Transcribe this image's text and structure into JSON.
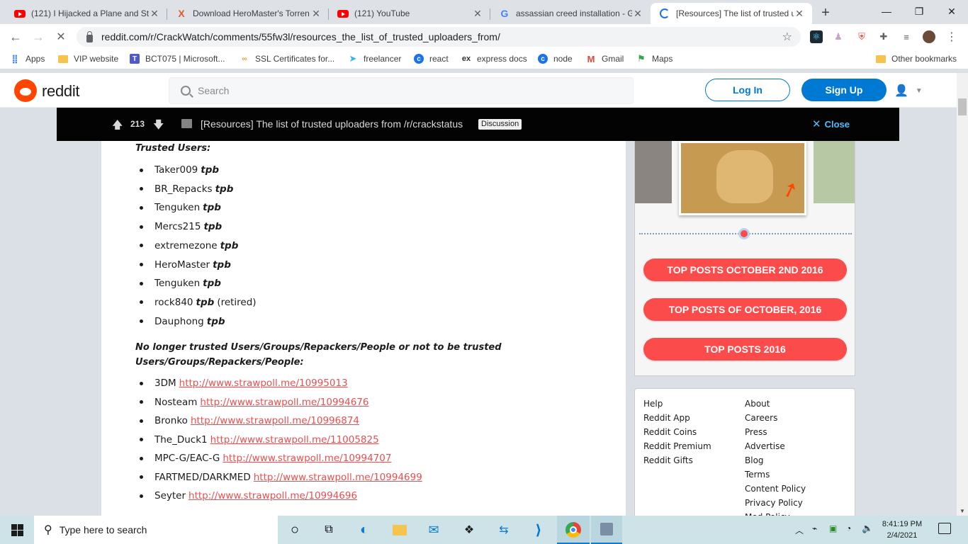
{
  "browser": {
    "tabs": [
      {
        "title": "(121) I Hijacked a Plane and St",
        "icon": "youtube-icon"
      },
      {
        "title": "Download HeroMaster's Torren",
        "icon": "x-site-icon"
      },
      {
        "title": "(121) YouTube",
        "icon": "youtube-icon"
      },
      {
        "title": "assassian creed installation - G",
        "icon": "google-icon"
      },
      {
        "title": "[Resources] The list of trusted u",
        "icon": "loading-icon"
      }
    ],
    "new_tab": "+",
    "window_controls": {
      "minimize": "—",
      "restore": "❐",
      "close": "✕"
    },
    "url": "reddit.com/r/CrackWatch/comments/55fw3l/resources_the_list_of_trusted_uploaders_from/",
    "bookmarks": [
      {
        "label": "Apps",
        "icon": "apps-grid-icon"
      },
      {
        "label": "VIP website",
        "icon": "folder-icon"
      },
      {
        "label": "BCT075 | Microsoft...",
        "icon": "teams-icon"
      },
      {
        "label": "SSL Certificates for...",
        "icon": "ssl-icon"
      },
      {
        "label": "freelancer",
        "icon": "freelancer-icon"
      },
      {
        "label": "react",
        "icon": "react-site-icon"
      },
      {
        "label": "express docs",
        "icon": "express-icon"
      },
      {
        "label": "node",
        "icon": "node-site-icon"
      },
      {
        "label": "Gmail",
        "icon": "gmail-icon"
      },
      {
        "label": "Maps",
        "icon": "maps-icon"
      }
    ],
    "other_bookmarks": "Other bookmarks"
  },
  "reddit": {
    "wordmark": "reddit",
    "search_placeholder": "Search",
    "login": "Log In",
    "signup": "Sign Up"
  },
  "postbar": {
    "votes": "213",
    "title": "[Resources] The list of trusted uploaders from /r/crackstatus",
    "flair": "Discussion",
    "close": "Close"
  },
  "post": {
    "trusted_heading": "Trusted Users:",
    "trusted": [
      {
        "name": "Taker009",
        "tag": "tpb",
        "note": ""
      },
      {
        "name": "BR_Repacks",
        "tag": "tpb",
        "note": ""
      },
      {
        "name": "Tenguken",
        "tag": "tpb",
        "note": ""
      },
      {
        "name": "Mercs215",
        "tag": "tpb",
        "note": ""
      },
      {
        "name": "extremezone",
        "tag": "tpb",
        "note": ""
      },
      {
        "name": "HeroMaster",
        "tag": "tpb",
        "note": ""
      },
      {
        "name": "Tenguken",
        "tag": "tpb",
        "note": ""
      },
      {
        "name": "rock840",
        "tag": "tpb",
        "note": "(retired)"
      },
      {
        "name": "Dauphong",
        "tag": "tpb",
        "note": ""
      }
    ],
    "untrusted_heading_1": "No longer trusted Users/Groups/Repackers/People or not to be trusted",
    "untrusted_heading_2": "Users/Groups/Repackers/People:",
    "untrusted": [
      {
        "name": "3DM",
        "link": "http://www.strawpoll.me/10995013"
      },
      {
        "name": "Nosteam",
        "link": "http://www.strawpoll.me/10994676"
      },
      {
        "name": "Bronko",
        "link": "http://www.strawpoll.me/10996874"
      },
      {
        "name": "The_Duck1",
        "link": "http://www.strawpoll.me/11005825"
      },
      {
        "name": "MPC-G/EAC-G",
        "link": "http://www.strawpoll.me/10994707"
      },
      {
        "name": "FARTMED/DARKMED",
        "link": "http://www.strawpoll.me/10994699"
      },
      {
        "name": "Seyter",
        "link": "http://www.strawpoll.me/10994696"
      }
    ]
  },
  "sidebar": {
    "top_buttons": [
      "TOP POSTS OCTOBER 2ND 2016",
      "TOP POSTS OF OCTOBER, 2016",
      "TOP POSTS 2016"
    ],
    "footer_left": [
      "Help",
      "Reddit App",
      "Reddit Coins",
      "Reddit Premium",
      "Reddit Gifts"
    ],
    "footer_right": [
      "About",
      "Careers",
      "Press",
      "Advertise",
      "Blog",
      "Terms",
      "Content Policy",
      "Privacy Policy",
      "Mod Policy"
    ]
  },
  "taskbar": {
    "search_placeholder": "Type here to search",
    "time": "8:41:19 PM",
    "date": "2/4/2021"
  },
  "colors": {
    "accent": "#0079d3",
    "link": "#ea4f4f",
    "top_button": "#fc4b4b",
    "reddit_orange": "#ff4500"
  }
}
